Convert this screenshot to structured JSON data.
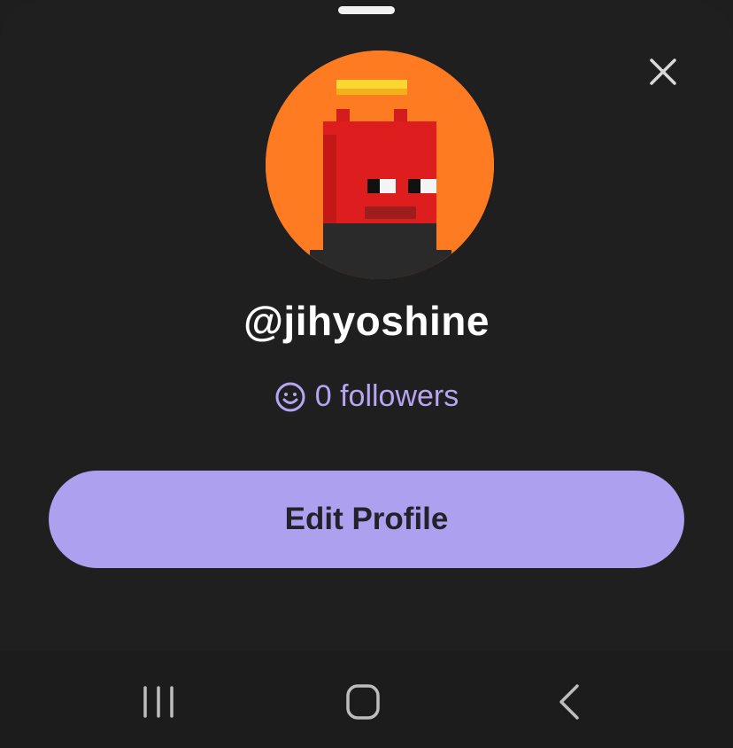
{
  "profile": {
    "username": "@jihyoshine",
    "followers_text": "0 followers",
    "edit_button_label": "Edit Profile"
  },
  "icons": {
    "close": "close-icon",
    "followers": "smiley-icon",
    "nav_recents": "recents-icon",
    "nav_home": "home-icon",
    "nav_back": "back-icon"
  },
  "colors": {
    "background": "#1f1f1f",
    "accent": "#ada1ef",
    "followers_text": "#b4a6f2",
    "avatar_bg": "#ff7b22"
  }
}
